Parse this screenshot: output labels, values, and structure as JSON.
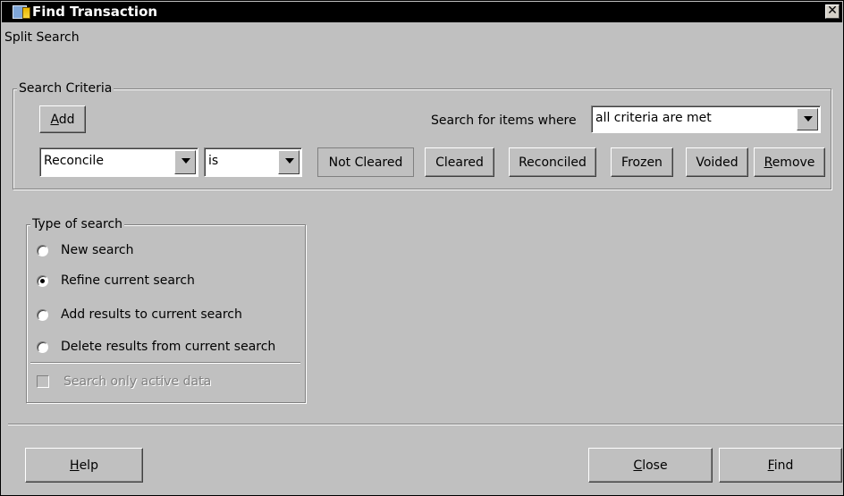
{
  "window": {
    "title": "Find Transaction",
    "close_glyph": "✕"
  },
  "split_search_label": "Split Search",
  "search_criteria": {
    "legend": "Search Criteria",
    "add_button": {
      "mnemonic": "A",
      "rest": "dd"
    },
    "search_for_label": "Search for items where",
    "match_mode": "all criteria are met",
    "row": {
      "field": "Reconcile",
      "operator": "is",
      "toggles": [
        "Not Cleared",
        "Cleared",
        "Reconciled",
        "Frozen",
        "Voided"
      ],
      "remove_button": {
        "mnemonic": "R",
        "rest": "emove"
      }
    }
  },
  "type_of_search": {
    "legend": "Type of search",
    "options": [
      {
        "label": "New search",
        "checked": false
      },
      {
        "label": "Refine current search",
        "checked": true
      },
      {
        "label": "Add results to current search",
        "checked": false
      },
      {
        "label": "Delete results from current search",
        "checked": false
      }
    ],
    "active_only": {
      "label": "Search only active data",
      "checked": false,
      "enabled": false
    }
  },
  "footer": {
    "help_button": {
      "mnemonic": "H",
      "rest": "elp"
    },
    "close_button": {
      "mnemonic": "C",
      "rest": "lose"
    },
    "find_button": {
      "mnemonic": "F",
      "rest": "ind"
    }
  },
  "icons": {
    "app": "find-transaction-app-icon",
    "close": "close-icon",
    "dropdown": "chevron-down-icon"
  }
}
